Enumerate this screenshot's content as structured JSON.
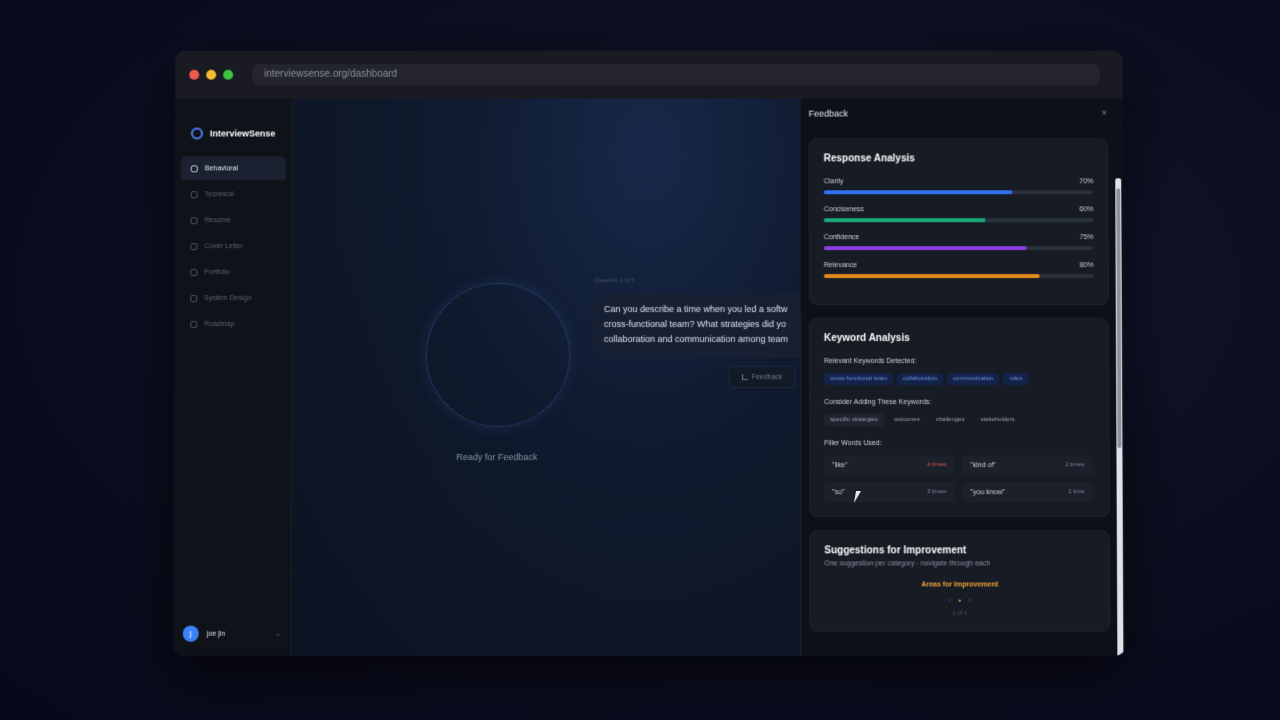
{
  "browser": {
    "url": "interviewsense.org/dashboard"
  },
  "app": {
    "name": "InterviewSense"
  },
  "sidebar": {
    "items": [
      {
        "label": "Behavioral",
        "icon": "person-icon",
        "active": true
      },
      {
        "label": "Technical",
        "icon": "monitor-icon"
      },
      {
        "label": "Resume",
        "icon": "document-icon"
      },
      {
        "label": "Cover Letter",
        "icon": "mail-icon"
      },
      {
        "label": "Portfolio",
        "icon": "folder-icon"
      },
      {
        "label": "System Design",
        "icon": "chart-icon"
      },
      {
        "label": "Roadmap",
        "icon": "pen-icon"
      }
    ],
    "user": {
      "initial": "j",
      "name": "joe jin",
      "chevron": "⌄"
    }
  },
  "main": {
    "status": "Ready for Feedback",
    "question_label": "Question 1 of 5",
    "question_lines": [
      "Can you describe a time when you led a softw",
      "cross-functional team? What strategies did yo",
      "collaboration and communication among team"
    ],
    "feedback_button": "Feedback"
  },
  "panel": {
    "title": "Feedback",
    "close": "×",
    "response_analysis": {
      "title": "Response Analysis",
      "metrics": [
        {
          "label": "Clarity",
          "value_text": "70%",
          "value": 0.7,
          "color": "#2f6ff0"
        },
        {
          "label": "Conciseness",
          "value_text": "60%",
          "value": 0.6,
          "color": "#18a777"
        },
        {
          "label": "Confidence",
          "value_text": "75%",
          "value": 0.75,
          "color": "#8b3fe0"
        },
        {
          "label": "Relevance",
          "value_text": "80%",
          "value": 0.8,
          "color": "#e58a1c"
        }
      ]
    },
    "keyword_analysis": {
      "title": "Keyword Analysis",
      "detected_label": "Relevant Keywords Detected:",
      "detected": [
        "cross-functional team",
        "collaboration",
        "communication",
        "roles"
      ],
      "consider_label": "Consider Adding These Keywords:",
      "consider": [
        "specific strategies",
        "outcomes",
        "challenges",
        "stakeholders"
      ],
      "filler_label": "Filler Words Used:",
      "fillers": [
        {
          "word": "\"like\"",
          "times": "4 times",
          "warn": true
        },
        {
          "word": "\"kind of\"",
          "times": "2 times",
          "warn": false
        },
        {
          "word": "\"so\"",
          "times": "3 times",
          "warn": false
        },
        {
          "word": "\"you know\"",
          "times": "1 time",
          "warn": false
        }
      ]
    },
    "suggestions": {
      "title": "Suggestions for Improvement",
      "subtitle": "One suggestion per category - navigate through each",
      "area": "Areas for Improvement",
      "prev": "‹",
      "dot": "•",
      "next": "›",
      "count": "1 of 1"
    }
  }
}
